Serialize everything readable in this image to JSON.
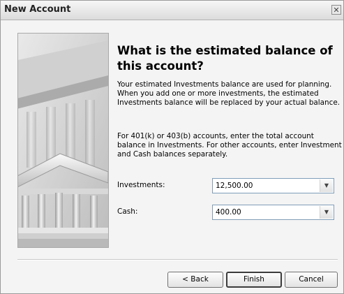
{
  "window": {
    "title": "New Account"
  },
  "content": {
    "heading": "What is the estimated balance of this account?",
    "paragraph1": "Your estimated Investments balance are used for planning. When you add one or more investments, the estimated Investments balance will be replaced by your actual balance.",
    "paragraph2": "For 401(k) or 403(b) accounts, enter the total account balance in Investments. For other accounts, enter Investment and Cash balances separately."
  },
  "fields": {
    "investments": {
      "label": "Investments:",
      "value": "12,500.00"
    },
    "cash": {
      "label": "Cash:",
      "value": "400.00"
    }
  },
  "buttons": {
    "back": "< Back",
    "finish": "Finish",
    "cancel": "Cancel"
  },
  "icons": {
    "close": "close-icon",
    "dropdown": "chevron-down-icon"
  }
}
